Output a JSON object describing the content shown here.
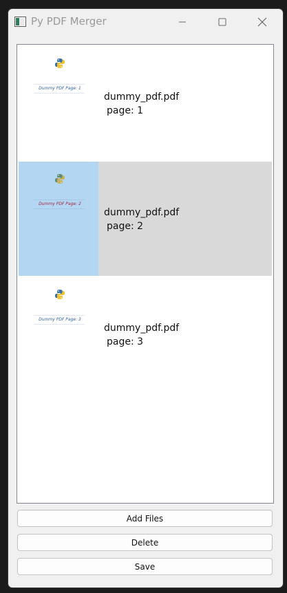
{
  "window": {
    "title": "Py PDF Merger",
    "icons": {
      "app": "app-window-icon",
      "minimize": "minimize-icon",
      "maximize": "maximize-icon",
      "close": "close-icon"
    }
  },
  "list": {
    "items": [
      {
        "file": "dummy_pdf.pdf",
        "page": "page: 1",
        "thumb_caption": "Dummy PDF Page: 1",
        "selected": false
      },
      {
        "file": "dummy_pdf.pdf",
        "page": "page: 2",
        "thumb_caption": "Dummy PDF Page: 2",
        "selected": true
      },
      {
        "file": "dummy_pdf.pdf",
        "page": "page: 3",
        "thumb_caption": "Dummy PDF Page: 3",
        "selected": false
      }
    ]
  },
  "buttons": {
    "add_files": "Add Files",
    "delete": "Delete",
    "save": "Save"
  },
  "colors": {
    "selection_row": "#d9d9d9",
    "selection_thumb": "#b3d7f3",
    "caption_blue": "#2f5fa0",
    "caption_selected": "#a0244a"
  }
}
